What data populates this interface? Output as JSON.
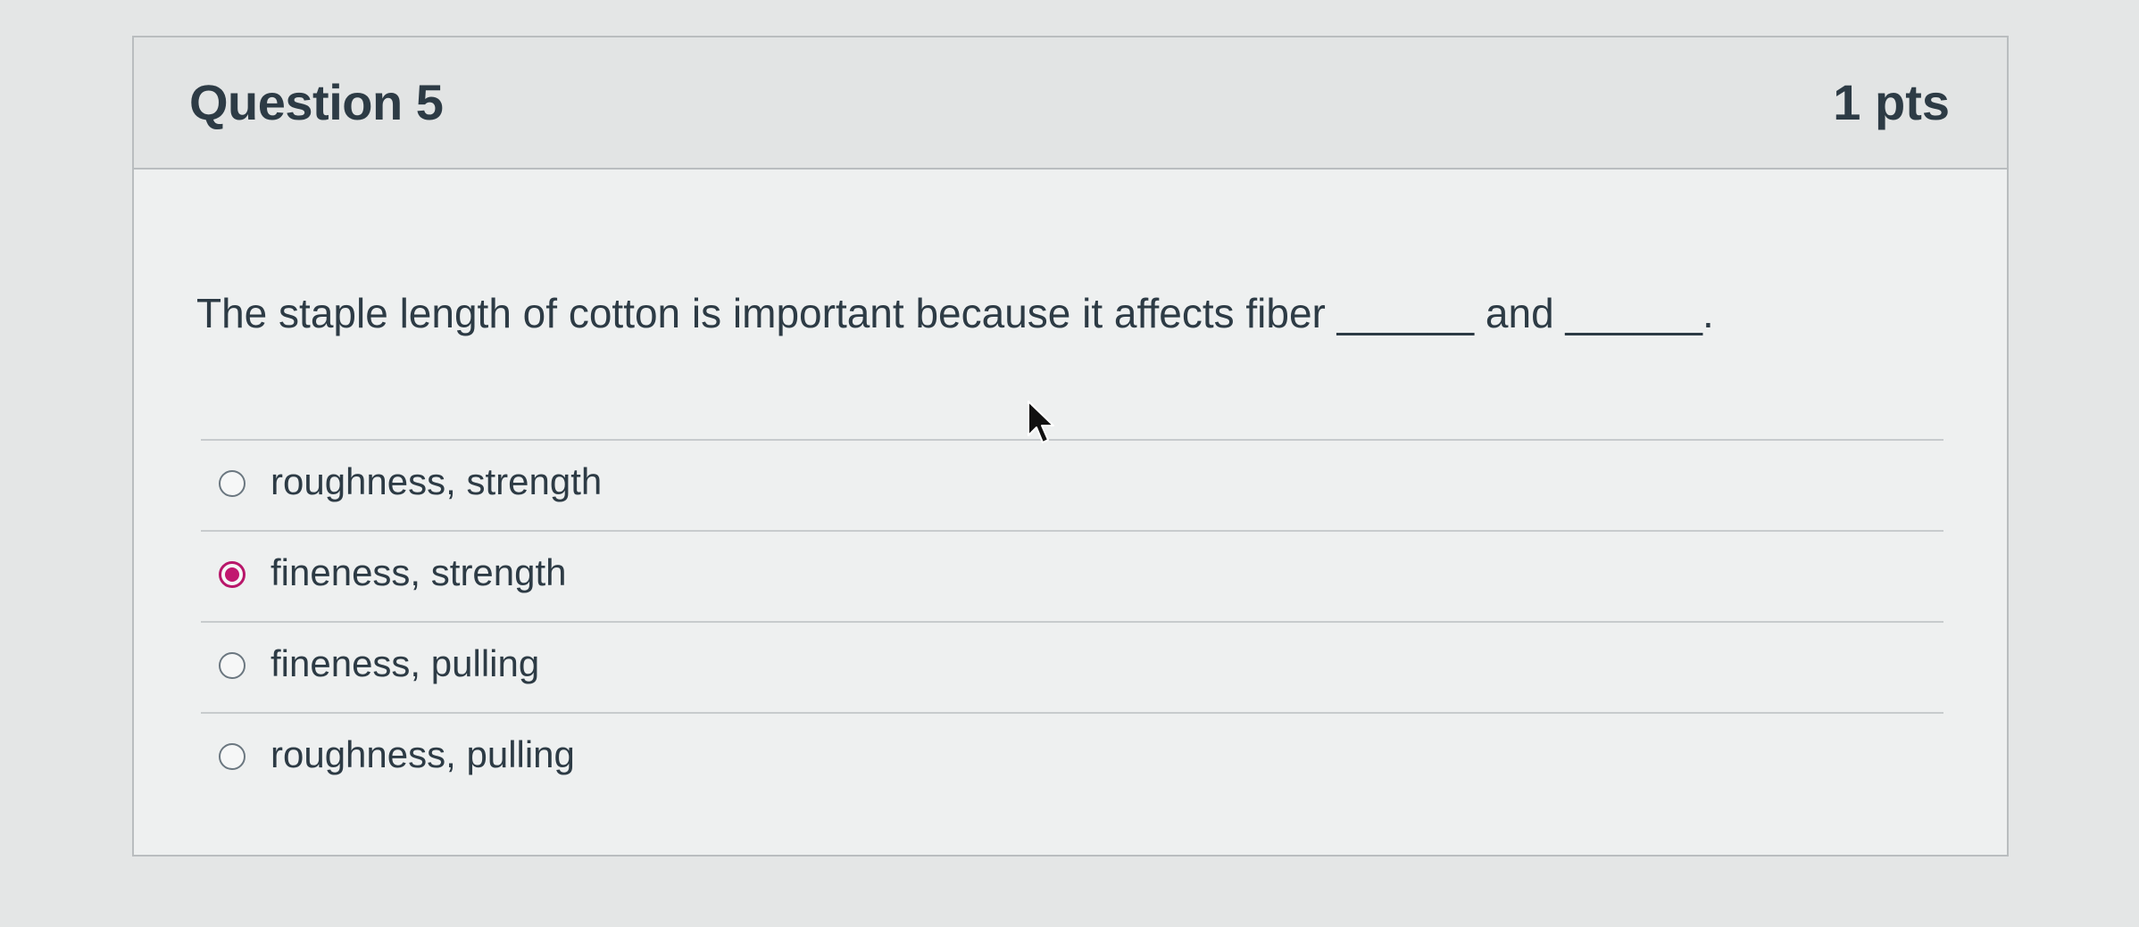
{
  "question": {
    "title": "Question 5",
    "points": "1 pts",
    "text": "The staple length of cotton is important because it affects fiber ______ and ______.",
    "answers": [
      {
        "label": "roughness, strength",
        "selected": false
      },
      {
        "label": "fineness, strength",
        "selected": true
      },
      {
        "label": "fineness, pulling",
        "selected": false
      },
      {
        "label": "roughness, pulling",
        "selected": false
      }
    ]
  },
  "colors": {
    "selected_radio": "#c1176f",
    "text": "#2d3b45",
    "header_bg": "#e2e4e4"
  },
  "icons": {
    "cursor": "mouse-pointer-icon"
  }
}
